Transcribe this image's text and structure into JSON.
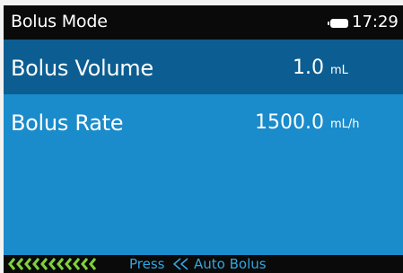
{
  "header": {
    "title": "Bolus Mode",
    "time": "17:29",
    "battery_icon": "battery-full-icon"
  },
  "rows": {
    "volume": {
      "label": "Bolus Volume",
      "value": "1.0",
      "unit": "mL"
    },
    "rate": {
      "label": "Bolus Rate",
      "value": "1500.0",
      "unit": "mL/h"
    }
  },
  "footer": {
    "press_label": "Press",
    "action_icon": "rewind-icon",
    "action_label": "Auto Bolus",
    "chevron_icon": "chevron-left-icon",
    "chevron_count": 11
  },
  "colors": {
    "accent_green": "#7fd13b",
    "footer_text": "#33a6e0",
    "selected_row": "#0c5e92",
    "screen_bg": "#1a8bcb"
  }
}
